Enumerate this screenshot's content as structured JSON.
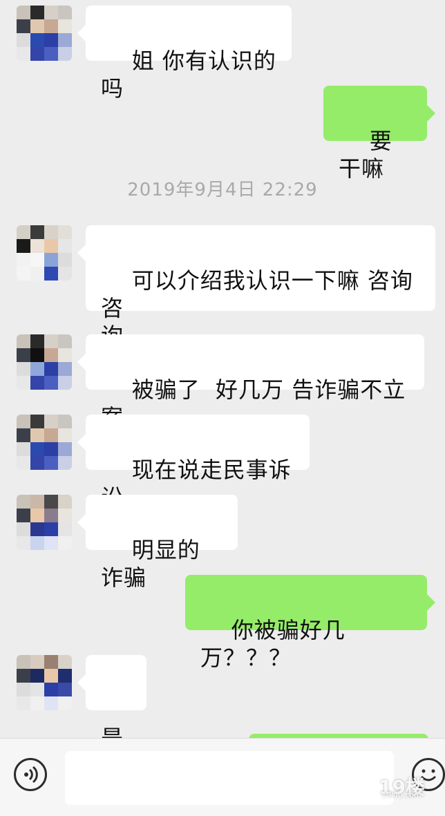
{
  "messages": [
    {
      "text": "姐 你有认识的吗"
    },
    {
      "text": "要干嘛"
    },
    {
      "text": "可以介绍我认识一下嘛 咨询咨\n询"
    },
    {
      "text": "被骗了  好几万 告诈骗不立案"
    },
    {
      "text": "现在说走民事诉讼"
    },
    {
      "text": "明显的诈骗"
    },
    {
      "text": "你被骗好几万？？？"
    },
    {
      "text": "是"
    }
  ],
  "timestamp": "2019年9月4日 22:29",
  "watermark": {
    "text": "19楼",
    "sub": "19lou.com"
  },
  "icons": {
    "voice": "voice-icon",
    "emoji": "emoji-icon"
  },
  "colors": {
    "outgoing": "#95ec69",
    "incoming": "#ffffff",
    "background": "#ededed"
  }
}
